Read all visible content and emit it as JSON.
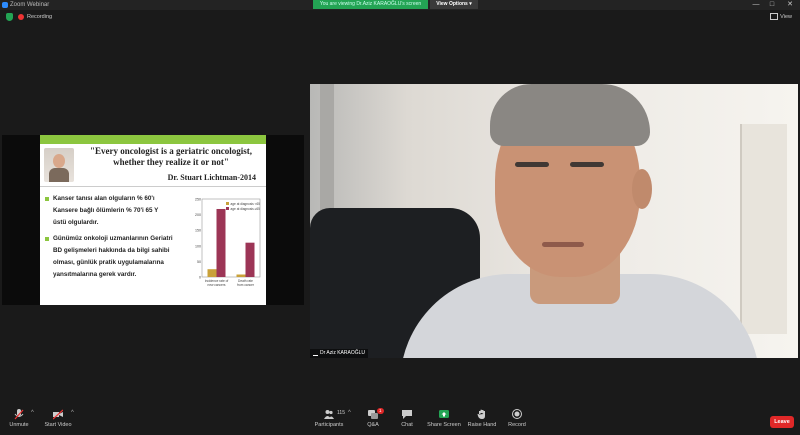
{
  "window": {
    "title": "Zoom Webinar",
    "viewing_banner": "You are viewing Dr.Aziz KARAOĞLU's screen",
    "view_options": "View Options ▾",
    "minimize": "—",
    "maximize": "□",
    "close": "✕"
  },
  "topbar": {
    "recording_label": "Recording",
    "view_label": "View"
  },
  "slide": {
    "quote_line1": "\"Every oncologist is a geriatric oncologist,",
    "quote_line2": "whether they realize it or not\"",
    "signature": "Dr. Stuart Lichtman-2014",
    "bullet1_line1": "Kanser tanısı alan olguların % 60'ı",
    "bullet1_line2": "Kansere  bağlı  ölümlerin     % 70'i  65 Y",
    "bullet1_line3": "üstü olgulardır.",
    "bullet2_line1": "Günümüz onkoloji uzmanlarının Geriatri",
    "bullet2_line2": "BD gelişmeleri hakkında da bilgi sahibi",
    "bullet2_line3": "olması, günlük pratik uygulamalarına",
    "bullet2_line4": "yansıtmalarına  gerek vardır.",
    "colors": {
      "accent_green": "#8cc63f"
    }
  },
  "chart_data": {
    "type": "bar",
    "categories": [
      "Incidence rate of new cancers",
      "Death rate from cancer"
    ],
    "series": [
      {
        "name": "age at diagnosis <65",
        "values": [
          25,
          8
        ],
        "color": "#c9a13a"
      },
      {
        "name": "age at diagnosis ≥65",
        "values": [
          218,
          110
        ],
        "color": "#9c3556"
      }
    ],
    "yticks": [
      "250",
      "200",
      "150",
      "100",
      "50",
      "0"
    ],
    "xlabels": [
      "Incidence rate of new cancers",
      "Death rate from cancer"
    ],
    "legend": [
      "age at diagnosis <65",
      "age at diagnosis ≥65"
    ],
    "ylim": [
      0,
      250
    ],
    "grid": false,
    "legend_position": "top-right"
  },
  "video": {
    "name_tag": "Dr Aziz KARAOĞLU"
  },
  "toolbar": {
    "unmute": "Unmute",
    "start_video": "Start Video",
    "participants": "Participants",
    "participants_count": "115",
    "qa": "Q&A",
    "qa_badge": "1",
    "chat": "Chat",
    "share_screen": "Share Screen",
    "raise_hand": "Raise Hand",
    "record": "Record",
    "leave": "Leave"
  }
}
